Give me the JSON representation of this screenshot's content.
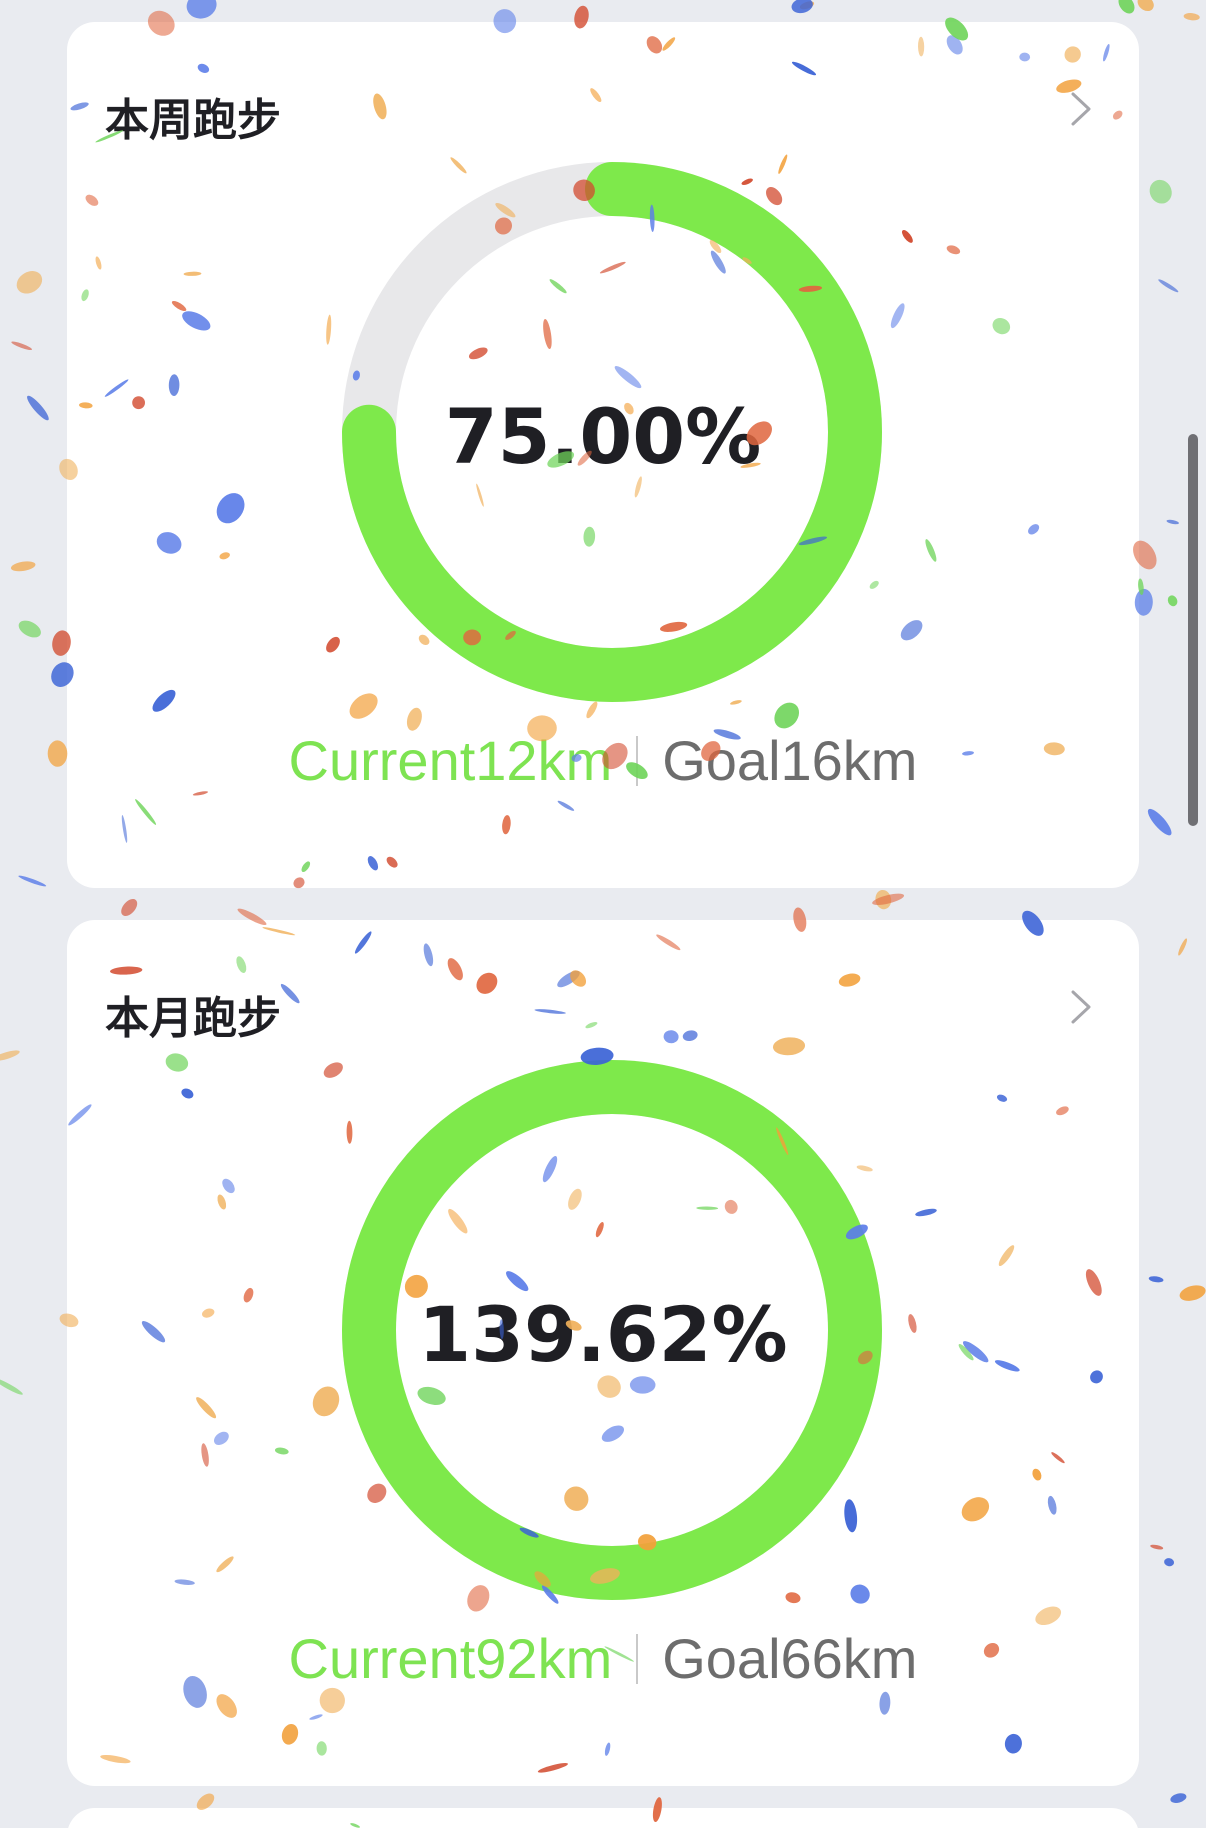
{
  "cards": [
    {
      "title": "本周跑步",
      "percent_text": "75.00%",
      "progress": 0.75,
      "current_text": "Current12km",
      "goal_text": "Goal16km"
    },
    {
      "title": "本月跑步",
      "percent_text": "139.62%",
      "progress": 1.3962,
      "current_text": "Current92km",
      "goal_text": "Goal66km"
    }
  ],
  "colors": {
    "progress": "#7ee94b",
    "track": "#e8e8ea",
    "current_text": "#7ee352",
    "goal_text": "#6d6d6d"
  },
  "icons": [
    "chevron-right-icon"
  ]
}
